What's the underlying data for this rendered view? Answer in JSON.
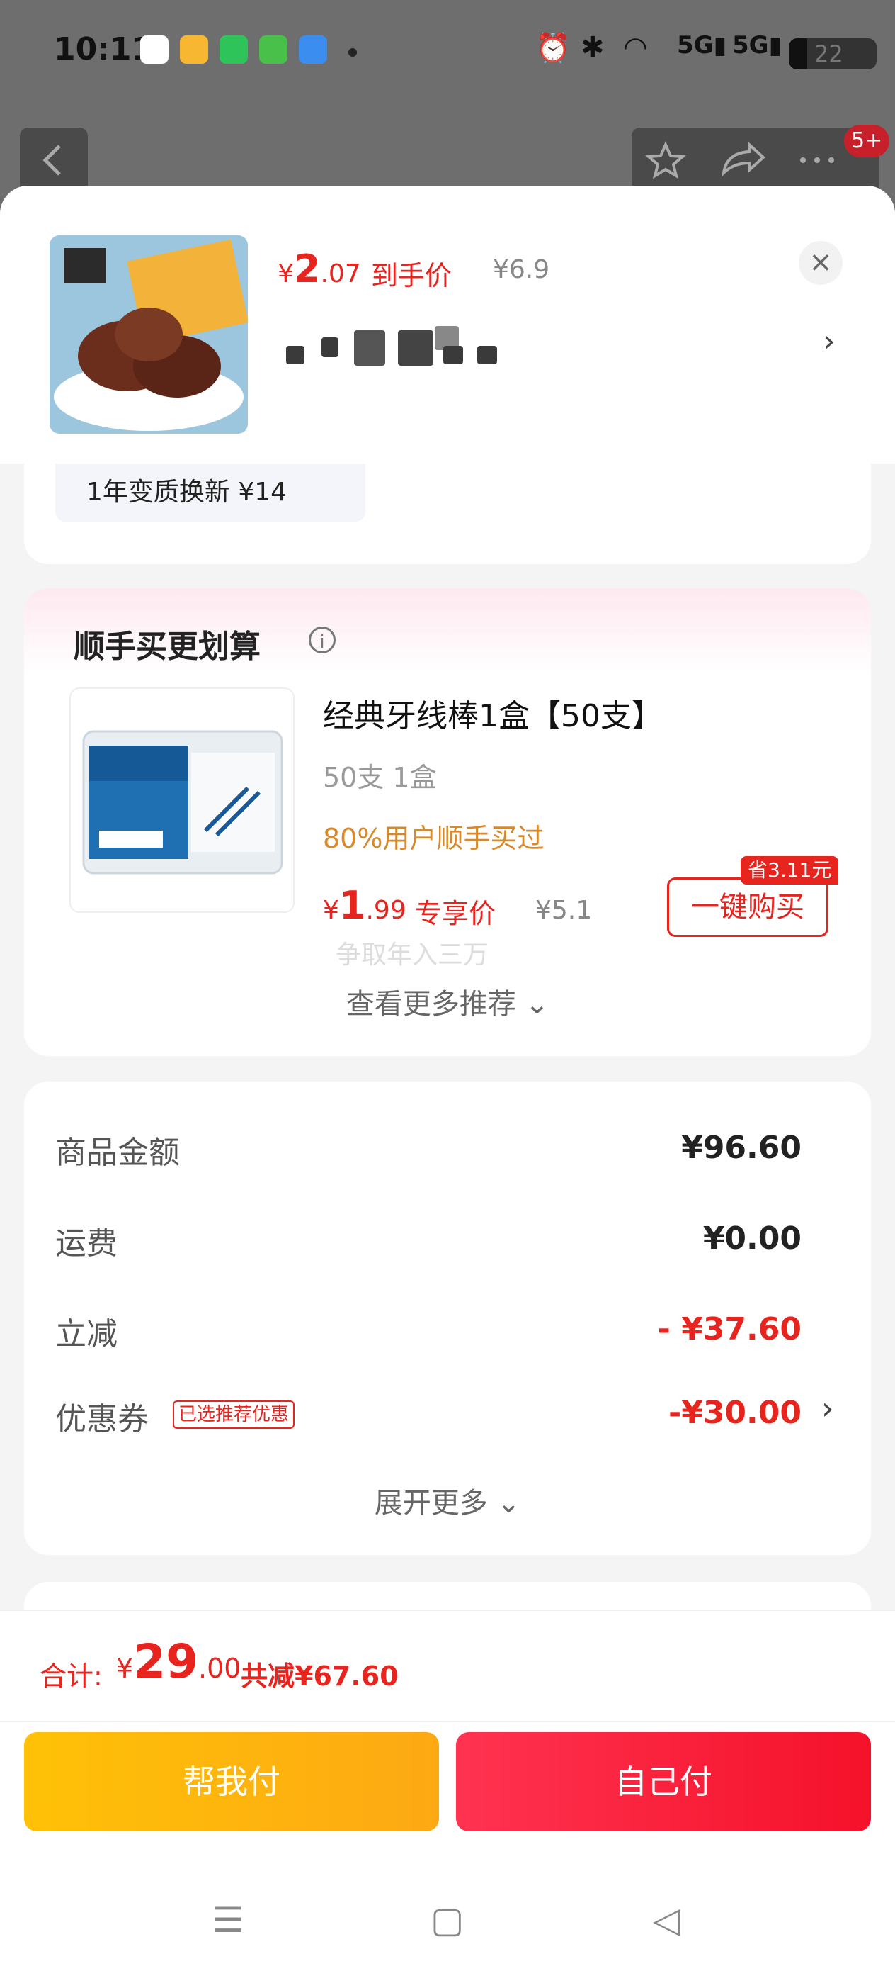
{
  "status_bar": {
    "time": "10:11",
    "battery": "22",
    "app_icons": [
      "slack-icon",
      "weibo-icon",
      "messages-icon",
      "green-app-icon",
      "blue-app-icon"
    ],
    "system_icons": [
      "alarm-icon",
      "bluetooth-icon",
      "wifi-icon",
      "5g-signal-icon",
      "5g-signal-icon"
    ]
  },
  "background_page": {
    "notification_badge": "5+"
  },
  "product": {
    "currency": "¥",
    "price_int": "2",
    "price_dec": ".07",
    "price_tag": "到手价",
    "original_price": "¥6.9",
    "close_symbol": "×",
    "chevron": "›"
  },
  "warranty": {
    "label": "1年变质换新 ¥14"
  },
  "recommend": {
    "title": "顺手买更划算",
    "info_symbol": "i",
    "item_name": "经典牙线棒1盒【50支】",
    "item_spec": "50支 1盒",
    "social_proof": "80%用户顺手买过",
    "currency": "¥",
    "price_int": "1",
    "price_dec": ".99",
    "price_tag": "专享价",
    "original_price": "¥5.1",
    "save_badge": "省3.11元",
    "buy_button": "一键购买",
    "faded_text": "争取年入三万",
    "more_label": "查看更多推荐",
    "more_chevron": "⌄"
  },
  "summary": {
    "rows": [
      {
        "label": "商品金额",
        "value": "¥96.60"
      },
      {
        "label": "运费",
        "value": "¥0.00"
      },
      {
        "label": "立减",
        "value": "- ¥37.60"
      },
      {
        "label": "优惠券",
        "value": "-¥30.00"
      }
    ],
    "coupon_tag": "已选推荐优惠",
    "coupon_chevron": "›",
    "expand_label": "展开更多",
    "expand_chevron": "⌄"
  },
  "footer": {
    "total_label": "合计:",
    "currency": "¥",
    "total_int": "29",
    "total_dec": ".00",
    "total_reduce": "共减¥67.60",
    "friend_pay": "帮我付",
    "self_pay": "自己付"
  },
  "nav": {
    "menu": "☰",
    "home": "▢",
    "back": "◁"
  },
  "colors": {
    "accent_red": "#e8241f",
    "gold": "#fdb913",
    "social_orange": "#d8892a"
  }
}
